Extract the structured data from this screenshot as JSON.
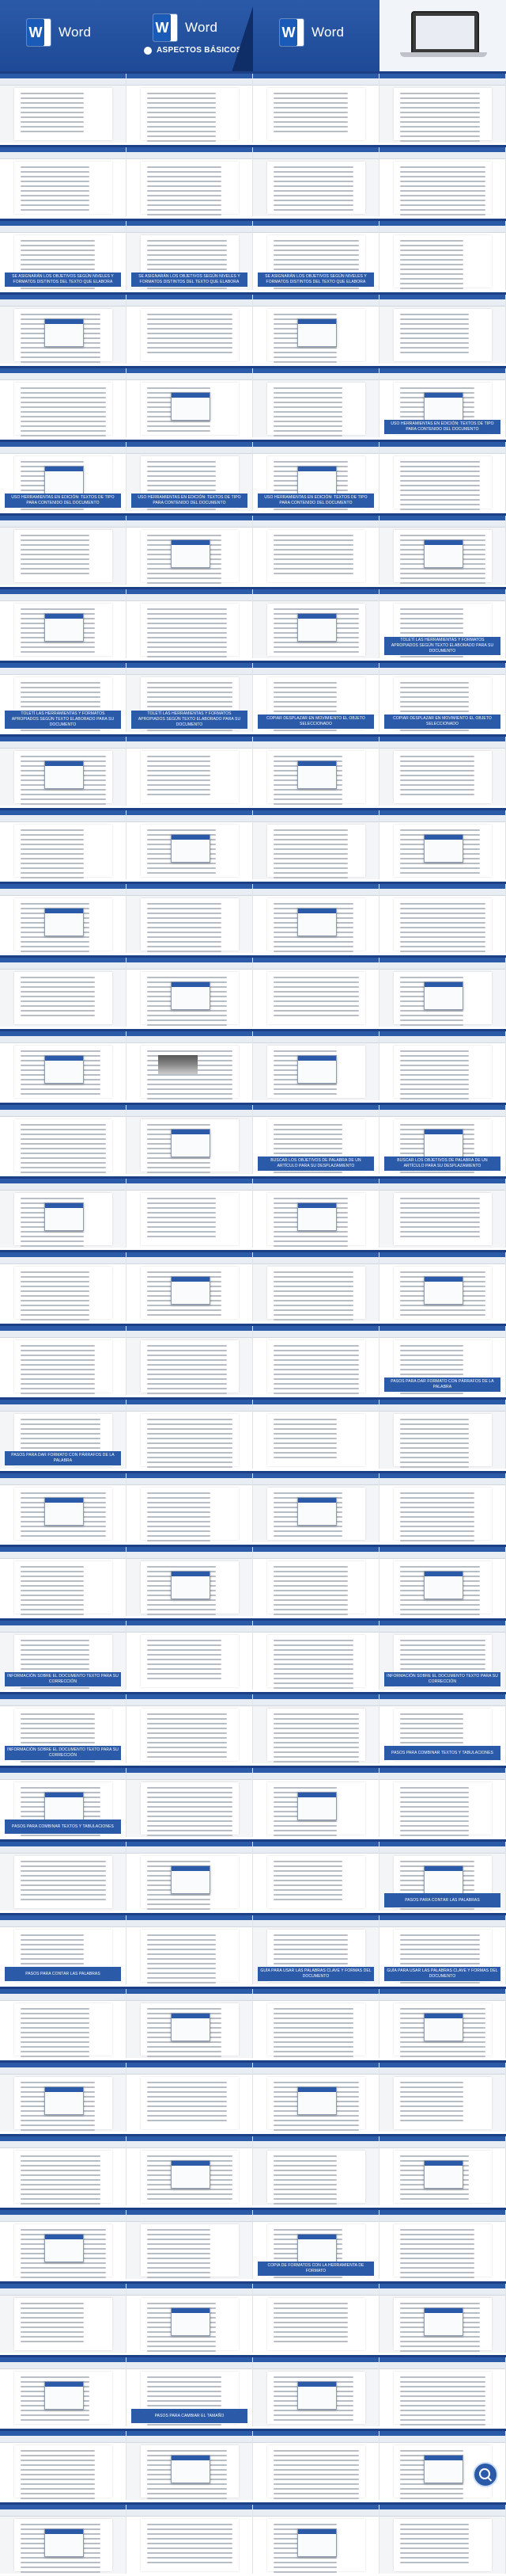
{
  "banner": {
    "tiles": [
      {
        "logo_text": "Word"
      },
      {
        "logo_text": "Word",
        "subtitle": "ASPECTOS BÁSICOS"
      },
      {
        "logo_text": "Word"
      }
    ]
  },
  "captions": {
    "r2_0": "SE ASIGNARÁN LOS OBJETIVOS SEGÚN NIVELES Y FORMATOS DISTINTOS DEL TEXTO QUE ELABORA",
    "r2_1": "SE ASIGNARÁN LOS OBJETIVOS SEGÚN NIVELES Y FORMATOS DISTINTOS DEL TEXTO QUE ELABORA",
    "r2_2": "SE ASIGNARÁN LOS OBJETIVOS SEGÚN NIVELES Y FORMATOS DISTINTOS DEL TEXTO QUE ELABORA",
    "r4_3": "USO HERRAMIENTAS EN EDICIÓN: TEXTOS DE TIPO PARA CONTENIDO DEL DOCUMENTO",
    "r5_0": "USO HERRAMIENTAS EN EDICIÓN: TEXTOS DE TIPO PARA CONTENIDO DEL DOCUMENTO",
    "r5_1": "USO HERRAMIENTAS EN EDICIÓN: TEXTOS DE TIPO PARA CONTENIDO DEL DOCUMENTO",
    "r5_2": "USO HERRAMIENTAS EN EDICIÓN: TEXTOS DE TIPO PARA CONTENIDO DEL DOCUMENTO",
    "r7_3": "TOLETÍ LAS HERRAMIENTAS Y FORMATOS APROPIADOS SEGÚN TEXTO ELABORADO PARA SU DOCUMENTO",
    "r8_0": "TOLETÍ LAS HERRAMIENTAS Y FORMATOS APROPIADOS SEGÚN TEXTO ELABORADO PARA SU DOCUMENTO",
    "r8_1": "TOLETÍ LAS HERRAMIENTAS Y FORMATOS APROPIADOS SEGÚN TEXTO ELABORADO PARA SU DOCUMENTO",
    "r8_2": "COPIAR DESPLAZAR EN MOVIMIENTO EL OBJETO SELECCIONADO",
    "r8_3": "COPIAR DESPLAZAR EN MOVIMIENTO EL OBJETO SELECCIONADO",
    "r14_2": "BUSCAR LOS OBJETIVOS DE PALABRA DE UN ARTÍCULO PARA SU DESPLAZAMIENTO",
    "r14_3": "BUSCAR LOS OBJETIVOS DE PALABRA DE UN ARTÍCULO PARA SU DESPLAZAMIENTO",
    "r17_3": "PASOS PARA DAR FORMATO CON PÁRRAFOS DE LA PALABRA",
    "r18_0": "PASOS PARA DAR FORMATO CON PÁRRAFOS DE LA PALABRA",
    "r21_0": "INFORMACIÓN SOBRE EL DOCUMENTO TEXTO PARA SU CORRECCIÓN",
    "r21_3": "INFORMACIÓN SOBRE EL DOCUMENTO TEXTO PARA SU CORRECCIÓN",
    "r22_0": "INFORMACIÓN SOBRE EL DOCUMENTO TEXTO PARA SU CORRECCIÓN",
    "r22_3": "PASOS PARA COMBINAR TEXTOS Y TABULACIONES",
    "r23_0": "PASOS PARA COMBINAR TEXTOS Y TABULACIONES",
    "r24_3": "PASOS PARA CONTAR LAS PALABRAS",
    "r25_0": "PASOS PARA CONTAR LAS PALABRAS",
    "r25_2": "GUÍA PARA USAR LAS PALABRAS CLAVE Y FORMAS DEL DOCUMENTO",
    "r25_3": "GUÍA PARA USAR LAS PALABRAS CLAVE Y FORMAS DEL DOCUMENTO",
    "r29_2": "COPIA DE FORMATOS CON LA HERRAMIENTA DE FORMATO",
    "r31_1": "PASOS PARA CAMBIAR EL TAMAÑO"
  }
}
